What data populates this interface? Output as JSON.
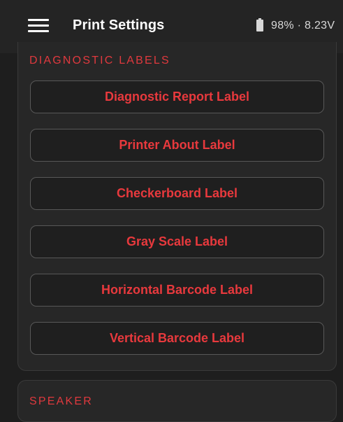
{
  "header": {
    "title": "Print Settings",
    "menu_icon": "hamburger-menu-icon",
    "battery_icon": "battery-icon",
    "battery_status": "98% · 8.23V"
  },
  "diagnostic_labels": {
    "section_title": "DIAGNOSTIC LABELS",
    "buttons": [
      "Diagnostic Report Label",
      "Printer About Label",
      "Checkerboard Label",
      "Gray Scale Label",
      "Horizontal Barcode Label",
      "Vertical Barcode Label"
    ]
  },
  "next_section": {
    "title": "SPEAKER"
  },
  "colors": {
    "accent": "#e8393d",
    "background": "#1e1e1e",
    "card": "#272727",
    "button_border": "#585858"
  }
}
